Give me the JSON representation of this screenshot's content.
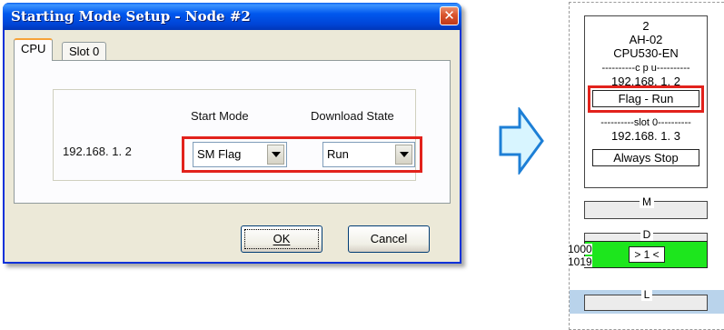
{
  "dialog": {
    "title": "Starting Mode Setup - Node #2",
    "close_label": "✕",
    "tabs": [
      {
        "label": "CPU",
        "active": true
      },
      {
        "label": "Slot 0",
        "active": false
      }
    ],
    "ip_address": "192.168.  1.  2",
    "start_mode": {
      "label": "Start Mode",
      "value": "SM Flag"
    },
    "download_state": {
      "label": "Download State",
      "value": "Run"
    },
    "ok_label": "OK",
    "cancel_label": "Cancel"
  },
  "node": {
    "number": "2",
    "model": "AH-02",
    "cpu_model": "CPU530-EN",
    "cpu_section": "----------c p u----------",
    "cpu_ip": "192.168.  1.  2",
    "cpu_mode": "Flag - Run",
    "slot_section": "----------slot 0----------",
    "slot_ip": "192.168.  1.  3",
    "slot_mode": "Always Stop",
    "memory": {
      "m_label": "M",
      "d_label": "D",
      "d_start": "1000",
      "d_end": "1019",
      "d_value": "> 1 <",
      "l_label": "L"
    }
  },
  "colors": {
    "highlight": "#e2221c",
    "titlebar": "#0058ee",
    "arrow_fill": "#d8f5ff",
    "arrow_stroke": "#1d7fd6",
    "green": "#1de61d",
    "band": "#b9d3eb"
  }
}
